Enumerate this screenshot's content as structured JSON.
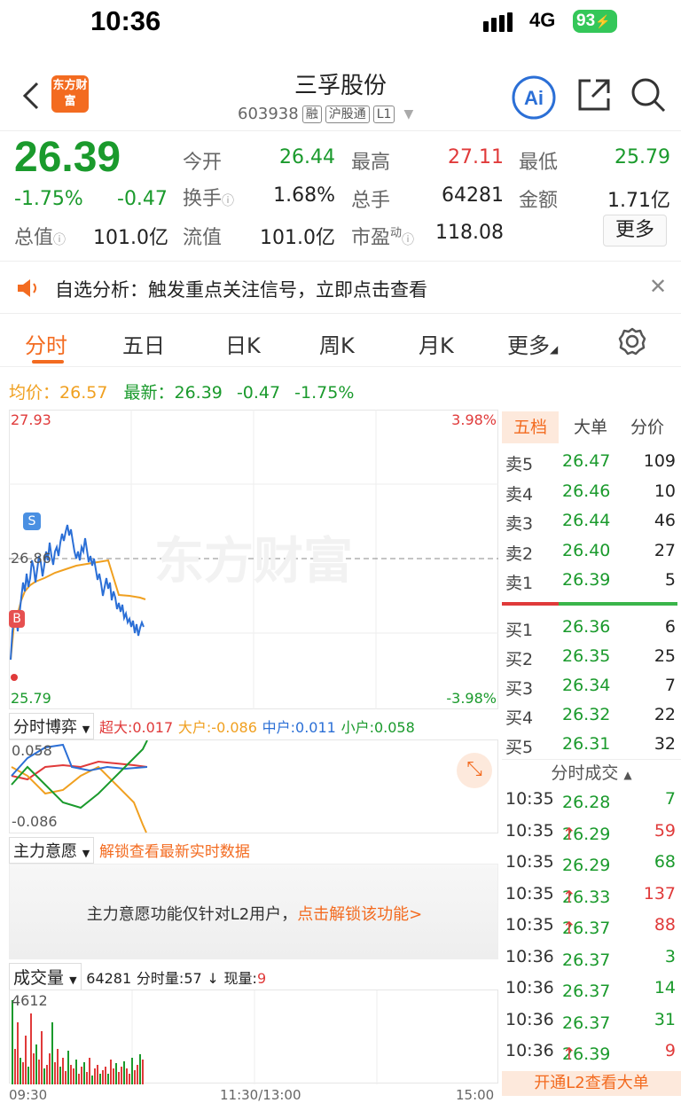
{
  "status_bar": {
    "time": "10:36",
    "network": "4G",
    "battery": "93"
  },
  "header": {
    "back_label": "<",
    "logo_text": "东方财富",
    "stock_name": "三孚股份",
    "code": "603938",
    "tags": [
      "融",
      "沪股通",
      "L1"
    ]
  },
  "quote": {
    "price": "26.39",
    "change_pct": "-1.75%",
    "change": "-0.47",
    "open_label": "今开",
    "open": "26.44",
    "high_label": "最高",
    "high": "27.11",
    "low_label": "最低",
    "low": "25.79",
    "turnover_label": "换手",
    "turnover": "1.68%",
    "volume_label": "总手",
    "volume": "64281",
    "amount_label": "金额",
    "amount": "1.71亿",
    "mcap_label": "总值",
    "mcap": "101.0亿",
    "float_label": "流值",
    "float": "101.0亿",
    "pe_label": "市盈",
    "pe_sup": "动",
    "pe": "118.08",
    "more_label": "更多"
  },
  "notice": {
    "text": "自选分析：触发重点关注信号，立即点击查看"
  },
  "tabs": [
    "分时",
    "五日",
    "日K",
    "周K",
    "月K",
    "更多"
  ],
  "info_line": {
    "avg_label": "均价：",
    "avg": "26.57",
    "latest_label": "最新：",
    "latest": "26.39",
    "change": "-0.47",
    "pct": "-1.75%"
  },
  "chart": {
    "top_price": "27.93",
    "bottom_price": "25.79",
    "ref_price": "26.86",
    "top_pct": "3.98%",
    "bottom_pct": "-3.98%",
    "watermark": "东方财富",
    "marker_s": "S",
    "marker_b": "B"
  },
  "game_panel": {
    "label": "分时博弈",
    "super_label": "超大:",
    "super": "0.017",
    "big_label": "大户:",
    "big": "-0.086",
    "mid_label": "中户:",
    "mid": "0.011",
    "small_label": "小户:",
    "small": "0.058",
    "ymax": "0.058",
    "ymin": "-0.086"
  },
  "intent_panel": {
    "label": "主力意愿",
    "unlock": "解锁查看最新实时数据",
    "body_text": "主力意愿功能仅针对L2用户，",
    "body_link": "点击解锁该功能>"
  },
  "volume_panel": {
    "label": "成交量",
    "total": "64281",
    "minute_label": "分时量:",
    "minute": "57",
    "now_label": "现量:",
    "now": "9",
    "ymax": "4612",
    "time_start": "09:30",
    "time_mid": "11:30/13:00",
    "time_end": "15:00"
  },
  "order_tabs": [
    "五档",
    "大单",
    "分价"
  ],
  "asks": [
    {
      "label": "卖5",
      "price": "26.47",
      "qty": "109"
    },
    {
      "label": "卖4",
      "price": "26.46",
      "qty": "10"
    },
    {
      "label": "卖3",
      "price": "26.44",
      "qty": "46"
    },
    {
      "label": "卖2",
      "price": "26.40",
      "qty": "27"
    },
    {
      "label": "卖1",
      "price": "26.39",
      "qty": "5"
    }
  ],
  "bids": [
    {
      "label": "买1",
      "price": "26.36",
      "qty": "6"
    },
    {
      "label": "买2",
      "price": "26.35",
      "qty": "25"
    },
    {
      "label": "买3",
      "price": "26.34",
      "qty": "7"
    },
    {
      "label": "买4",
      "price": "26.32",
      "qty": "22"
    },
    {
      "label": "买5",
      "price": "26.31",
      "qty": "32"
    }
  ],
  "trades_title": "分时成交",
  "trades": [
    {
      "time": "10:35",
      "price": "26.28",
      "qty": "7",
      "dir": ""
    },
    {
      "time": "10:35",
      "price": "26.29",
      "qty": "59",
      "dir": "↑"
    },
    {
      "time": "10:35",
      "price": "26.29",
      "qty": "68",
      "dir": ""
    },
    {
      "time": "10:35",
      "price": "26.33",
      "qty": "137",
      "dir": "↑"
    },
    {
      "time": "10:35",
      "price": "26.37",
      "qty": "88",
      "dir": "↑"
    },
    {
      "time": "10:36",
      "price": "26.37",
      "qty": "3",
      "dir": ""
    },
    {
      "time": "10:36",
      "price": "26.37",
      "qty": "14",
      "dir": ""
    },
    {
      "time": "10:36",
      "price": "26.37",
      "qty": "31",
      "dir": ""
    },
    {
      "time": "10:36",
      "price": "26.39",
      "qty": "9",
      "dir": "↑"
    }
  ],
  "l2_banner": "开通L2查看大单",
  "colors": {
    "up": "#e03a3a",
    "down": "#1a9a2c",
    "avg": "#f0a020",
    "price_line": "#2b6fd6",
    "brand": "#f36b20"
  }
}
